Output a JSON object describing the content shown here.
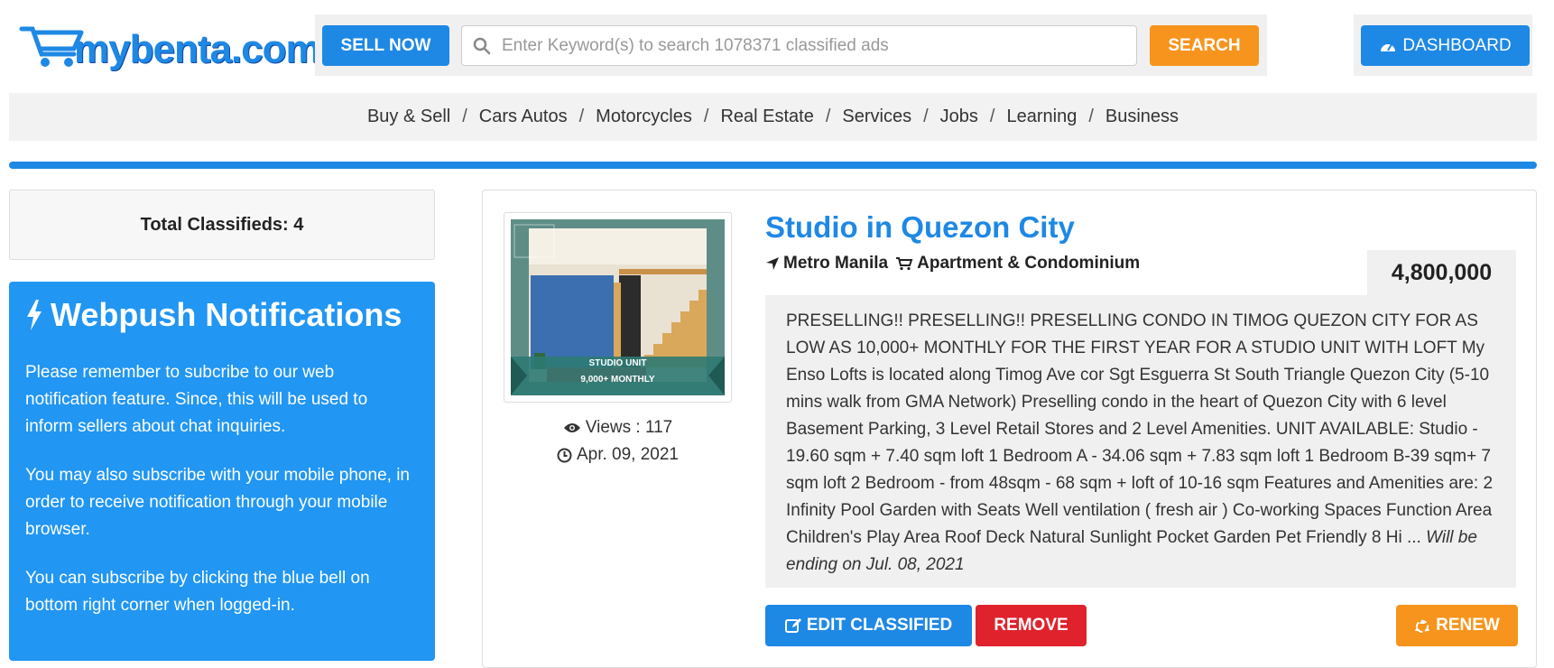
{
  "brand": {
    "logo_text": "mybenta.com"
  },
  "header": {
    "sell_label": "SELL NOW",
    "search_placeholder": "Enter Keyword(s) to search 1078371 classified ads",
    "search_label": "SEARCH",
    "dashboard_label": "DASHBOARD"
  },
  "nav": {
    "items": [
      "Buy & Sell",
      "Cars Autos",
      "Motorcycles",
      "Real Estate",
      "Services",
      "Jobs",
      "Learning",
      "Business"
    ],
    "separator": "/"
  },
  "sidebar": {
    "total_label": "Total Classifieds: 4",
    "webpush_title": "Webpush Notifications",
    "paragraphs": [
      "Please remember to subcribe to our web notification feature. Since, this will be used to inform sellers about chat inquiries.",
      "You may also subscribe with your mobile phone, in order to receive notification through your mobile browser.",
      "You can subscribe by clicking the blue bell on bottom right corner when logged-in."
    ]
  },
  "listing": {
    "title": "Studio in Quezon City",
    "location": "Metro Manila",
    "category": "Apartment & Condominium",
    "price": "4,800,000",
    "thumb_caption_1": "STUDIO UNIT",
    "thumb_caption_2": "9,000+ MONTHLY",
    "views": "Views : 117",
    "date": "Apr. 09, 2021",
    "description": "PRESELLING!! PRESELLING!! PRESELLING CONDO IN TIMOG QUEZON CITY FOR AS LOW AS 10,000+ MONTHLY FOR THE FIRST YEAR FOR A STUDIO UNIT WITH LOFT My Enso Lofts is located along Timog Ave cor Sgt Esguerra St South Triangle Quezon City (5-10 mins walk from GMA Network) Preselling condo in the heart of Quezon City with 6 level Basement Parking, 3 Level Retail Stores and 2 Level Amenities. UNIT AVAILABLE: Studio - 19.60 sqm + 7.40 sqm loft 1 Bedroom A - 34.06 sqm + 7.83 sqm loft 1 Bedroom B-39 sqm+ 7 sqm loft 2 Bedroom - from 48sqm - 68 sqm + loft of 10-16 sqm Features and Amenities are: 2 Infinity Pool Garden with Seats Well ventilation ( fresh air ) Co-working Spaces Function Area Children's Play Area Roof Deck Natural Sunlight Pocket Garden Pet Friendly 8 Hi ...",
    "ending_note": "Will be ending on Jul. 08, 2021",
    "edit_label": "EDIT CLASSIFIED",
    "remove_label": "REMOVE",
    "renew_label": "RENEW"
  },
  "colors": {
    "primary": "#1e88e5",
    "accent": "#f7941d",
    "danger": "#e0222c",
    "panel": "#2196f3"
  },
  "icons": [
    "cart-logo-icon",
    "search-icon",
    "dashboard-icon",
    "bolt-icon",
    "location-arrow-icon",
    "cart-icon",
    "eye-icon",
    "clock-icon",
    "edit-icon",
    "recycle-icon"
  ]
}
